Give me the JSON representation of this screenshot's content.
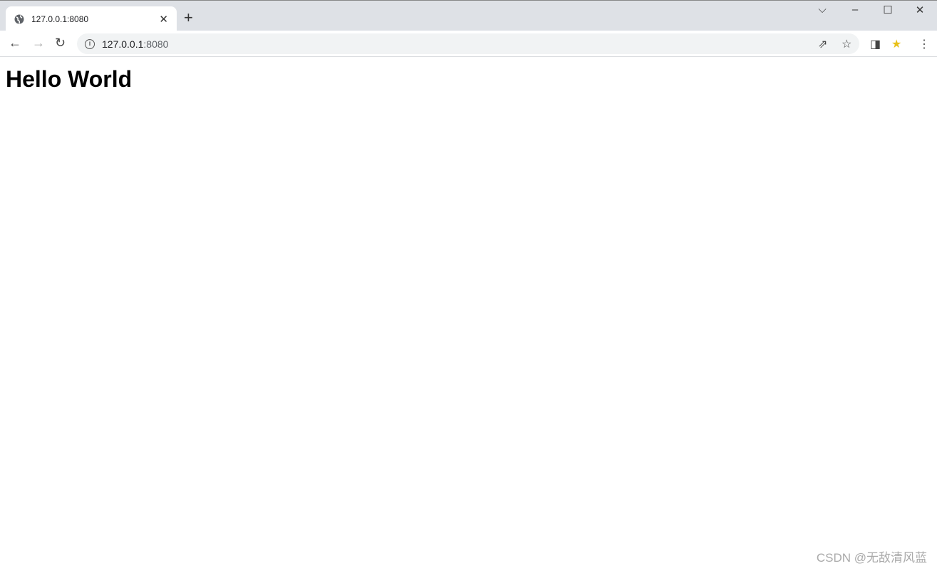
{
  "tab": {
    "title": "127.0.0.1:8080",
    "favicon": "globe-icon"
  },
  "address": {
    "host": "127.0.0.1",
    "port": ":8080"
  },
  "page": {
    "heading": "Hello World"
  },
  "watermark": "CSDN @无敌清风蓝"
}
